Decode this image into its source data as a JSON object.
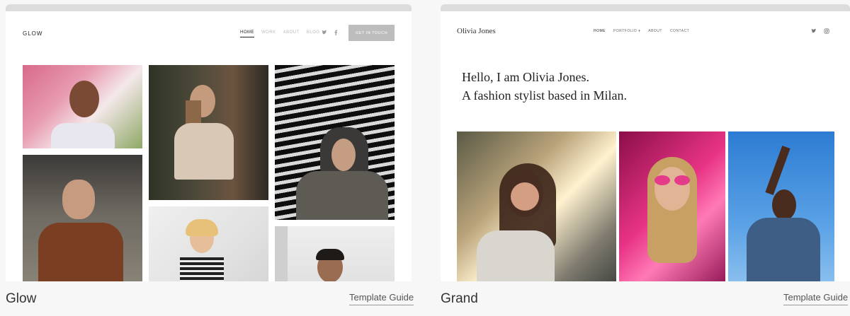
{
  "cards": [
    {
      "caption": "Glow",
      "guide_label": "Template Guide",
      "mock": {
        "logo": "GLOW",
        "nav": [
          "HOME",
          "WORK",
          "ABOUT",
          "BLOG"
        ],
        "cta": "GET IN TOUCH"
      }
    },
    {
      "caption": "Grand",
      "guide_label": "Template Guide",
      "mock": {
        "logo": "Olivia Jones",
        "nav": [
          "HOME",
          "PORTFOLIO ▾",
          "ABOUT",
          "CONTACT"
        ],
        "hero_line1": "Hello, I am Olivia Jones.",
        "hero_line2": "A fashion stylist based in Milan."
      }
    }
  ],
  "colors": {
    "page_bg": "#f7f7f7",
    "browser_bar": "#dcdcdc",
    "cta_bg": "#bdbdbd"
  },
  "icons": [
    "twitter-icon",
    "facebook-icon",
    "instagram-icon"
  ]
}
